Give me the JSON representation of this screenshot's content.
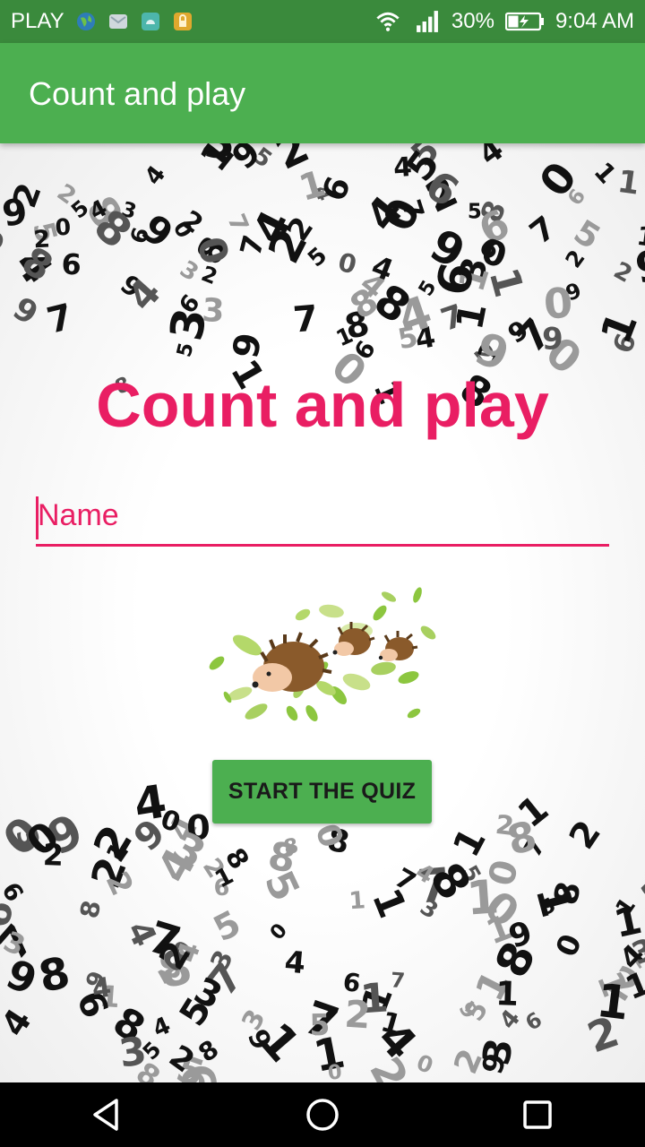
{
  "status_bar": {
    "carrier": "PLAY",
    "battery": "30%",
    "time": "9:04 AM",
    "color": "#3a8a3c"
  },
  "app_bar": {
    "title": "Count and play",
    "color": "#4caf50"
  },
  "main": {
    "title": "Count and play",
    "name_input": {
      "placeholder": "Name",
      "value": ""
    },
    "image": "hedgehog-family-illustration",
    "start_button_label": "START THE QUIZ",
    "accent_color": "#e91e63"
  },
  "nav_bar": {
    "buttons": [
      "back",
      "home",
      "recents"
    ]
  }
}
